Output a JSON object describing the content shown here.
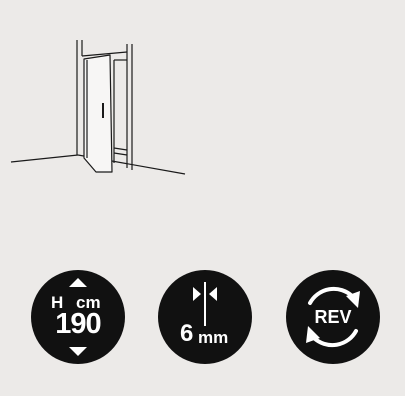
{
  "illustration": {
    "name": "open-door-in-wall-niche"
  },
  "badges": {
    "height": {
      "letter": "H",
      "unit": "cm",
      "value": "190",
      "icon": "up-down-arrows-icon"
    },
    "gap": {
      "value": "6",
      "unit": "mm",
      "icon": "gap-arrows-icon"
    },
    "reversible": {
      "label": "REV",
      "icon": "rotate-arrows-icon"
    }
  },
  "colors": {
    "background": "#eceae8",
    "badge": "#111111",
    "badge_text": "#ffffff",
    "line": "#1a1a1a"
  }
}
